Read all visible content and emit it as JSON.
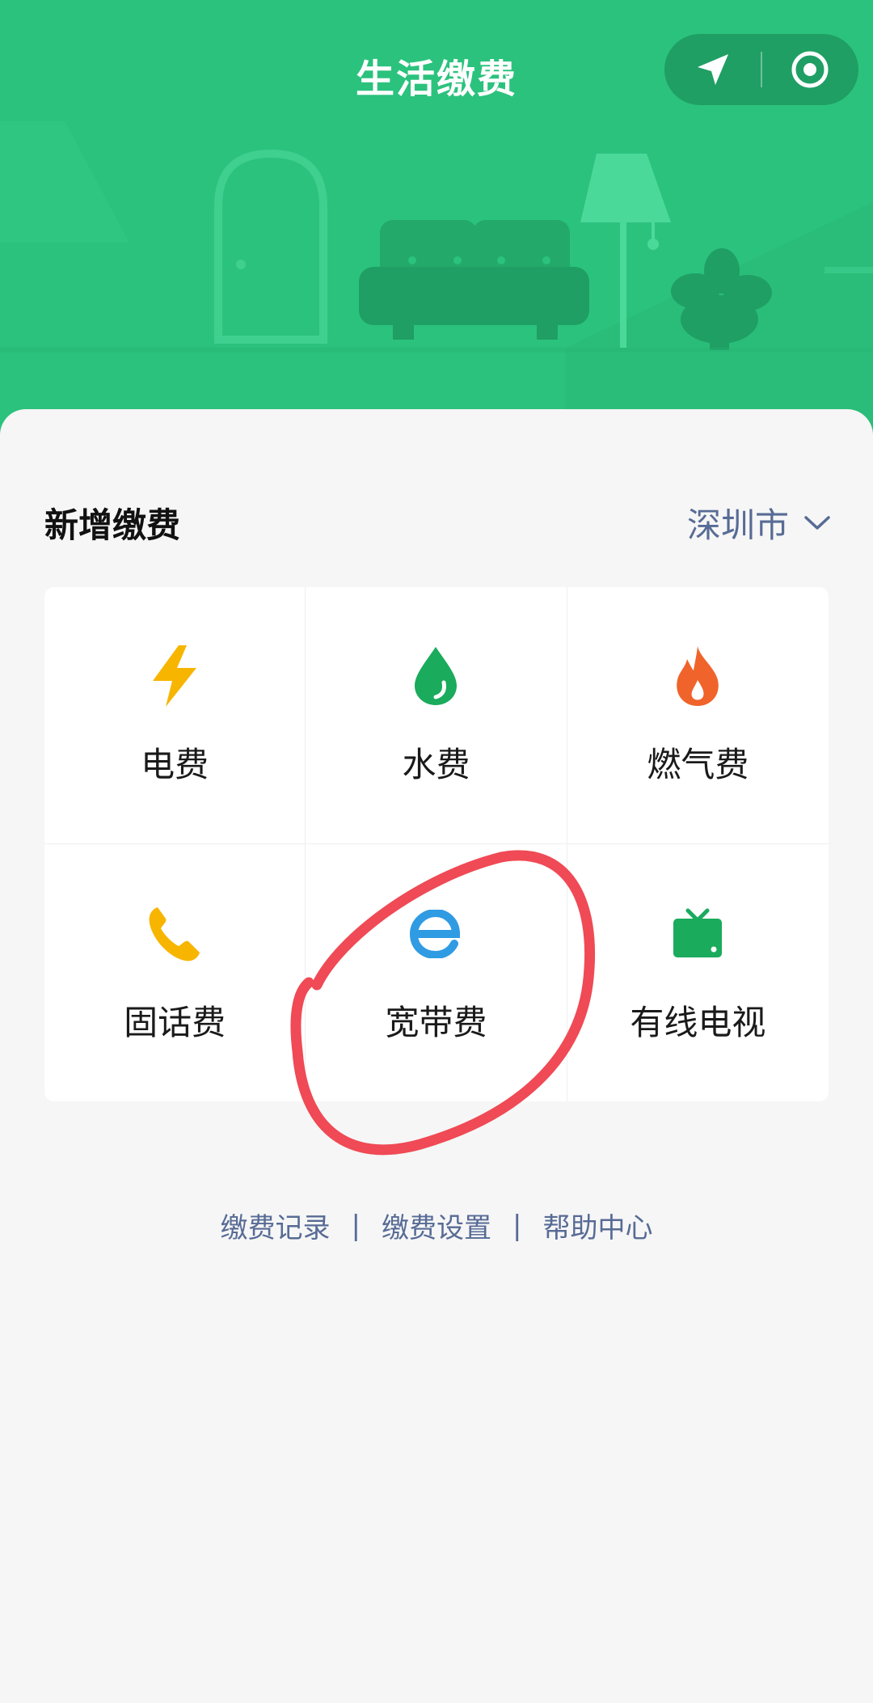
{
  "header": {
    "title": "生活缴费",
    "capsule": {
      "left_icon": "navigation-arrow-icon",
      "right_icon": "target-circle-icon"
    }
  },
  "section": {
    "title": "新增缴费",
    "city": "深圳市"
  },
  "services": [
    {
      "label": "电费",
      "icon": "lightning-icon",
      "color": "#f7b500"
    },
    {
      "label": "水费",
      "icon": "water-drop-icon",
      "color": "#1aab5c"
    },
    {
      "label": "燃气费",
      "icon": "flame-icon",
      "color": "#f0632a"
    },
    {
      "label": "固话费",
      "icon": "phone-icon",
      "color": "#f7b500"
    },
    {
      "label": "宽带费",
      "icon": "broadband-e-icon",
      "color": "#2f9be3"
    },
    {
      "label": "有线电视",
      "icon": "tv-icon",
      "color": "#1aab5c"
    }
  ],
  "footer": {
    "links": [
      "缴费记录",
      "缴费设置",
      "帮助中心"
    ],
    "separator": "|"
  },
  "colors": {
    "header_bg": "#2bc27d",
    "link": "#576b95",
    "annotation_circle": "#ef4a55"
  }
}
